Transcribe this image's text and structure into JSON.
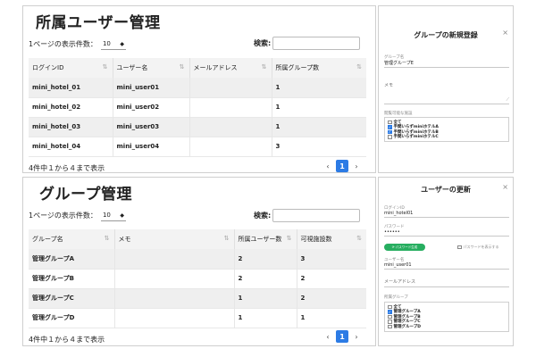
{
  "users_panel": {
    "title": "所属ユーザー管理",
    "length_label": "1ページの表示件数：",
    "length_value": "10",
    "search_label": "検索:",
    "columns": [
      "ログインID",
      "ユーザー名",
      "メールアドレス",
      "所属グループ数"
    ],
    "rows": [
      [
        "mini_hotel_01",
        "mini_user01",
        "",
        "1"
      ],
      [
        "mini_hotel_02",
        "mini_user02",
        "",
        "1"
      ],
      [
        "mini_hotel_03",
        "mini_user03",
        "",
        "1"
      ],
      [
        "mini_hotel_04",
        "mini_user04",
        "",
        "3"
      ]
    ],
    "info": "4件中１から４まで表示",
    "page": "1",
    "prev": "‹",
    "next": "›"
  },
  "new_group_modal": {
    "title": "グループの新規登録",
    "close": "×",
    "group_name_label": "グループ名",
    "group_name_value": "管理グループE",
    "memo_label": "メモ",
    "facilities_label": "閲覧可能な施設",
    "facilities": [
      {
        "label": "全て",
        "checked": false
      },
      {
        "label": "手間いらずminiホテルA",
        "checked": true
      },
      {
        "label": "手間いらずminiホテルB",
        "checked": true
      },
      {
        "label": "手間いらずminiホテルC",
        "checked": false
      }
    ]
  },
  "groups_panel": {
    "title": "グループ管理",
    "length_label": "1ページの表示件数：",
    "length_value": "10",
    "search_label": "検索:",
    "columns": [
      "グループ名",
      "メモ",
      "所属ユーザー数",
      "可視施設数"
    ],
    "rows": [
      [
        "管理グループA",
        "",
        "2",
        "3"
      ],
      [
        "管理グループB",
        "",
        "2",
        "2"
      ],
      [
        "管理グループC",
        "",
        "1",
        "2"
      ],
      [
        "管理グループD",
        "",
        "1",
        "1"
      ]
    ],
    "info": "4件中１から４まで表示",
    "page": "1",
    "prev": "‹",
    "next": "›"
  },
  "update_user_modal": {
    "title": "ユーザーの更新",
    "close": "×",
    "login_label": "ログインID",
    "login_value": "mini_hotel01",
    "password_label": "パスワード",
    "password_value": "••••••",
    "generate_label": "⟳ パスワード生成",
    "show_password_label": "パスワードを表示する",
    "username_label": "ユーザー名",
    "username_value": "mini_user01",
    "email_label": "メールアドレス",
    "groups_label": "所属グループ",
    "groups": [
      {
        "label": "全て",
        "checked": false
      },
      {
        "label": "管理グループA",
        "checked": true
      },
      {
        "label": "管理グループB",
        "checked": false
      },
      {
        "label": "管理グループC",
        "checked": false
      },
      {
        "label": "管理グループD",
        "checked": false
      }
    ]
  },
  "colors": {
    "accent": "#2c7be5",
    "generate_button": "#27ae60"
  }
}
